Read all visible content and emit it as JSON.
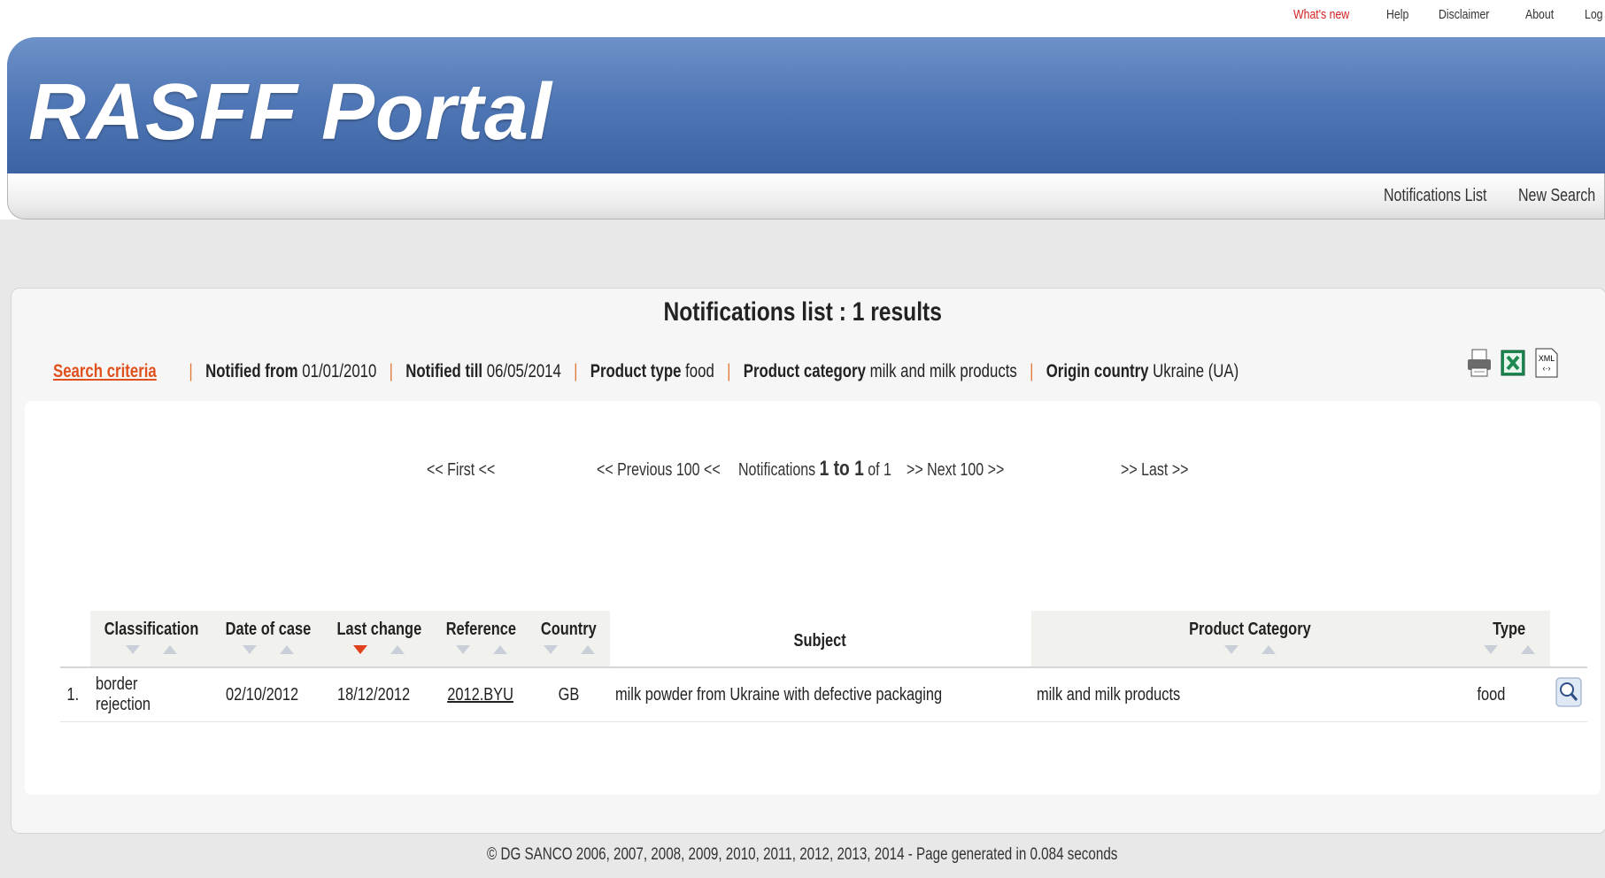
{
  "top_links": [
    "What's new",
    "Help",
    "Disclaimer",
    "About",
    "Log in"
  ],
  "header": {
    "title": "RASFF Portal"
  },
  "nav": {
    "notifications_list": "Notifications List",
    "new_search": "New Search"
  },
  "list_title": "Notifications list : 1 results",
  "criteria": {
    "link": "Search criteria",
    "items": [
      {
        "label": "Notified from",
        "value": "01/01/2010"
      },
      {
        "label": "Notified till",
        "value": "06/05/2014"
      },
      {
        "label": "Product type",
        "value": "food"
      },
      {
        "label": "Product category",
        "value": "milk and milk products"
      },
      {
        "label": "Origin country",
        "value": "Ukraine (UA)"
      }
    ]
  },
  "pager": {
    "first": "<< First <<",
    "previous": "<< Previous 100 <<",
    "notifications_prefix": "Notifications",
    "range": "1 to 1",
    "of_text": "of 1",
    "next": ">> Next 100 >>",
    "last": ">> Last >>"
  },
  "table": {
    "columns": [
      "Classification",
      "Date of case",
      "Last change",
      "Reference",
      "Country",
      "Subject",
      "Product Category",
      "Type"
    ],
    "rows": [
      {
        "index": "1.",
        "classification": "border rejection",
        "date_of_case": "02/10/2012",
        "last_change": "18/12/2012",
        "reference": "2012.BYU",
        "country": "GB",
        "subject": "milk powder from Ukraine with defective packaging",
        "product_category": "milk and milk products",
        "type": "food"
      }
    ]
  },
  "footer": "© DG SANCO 2006, 2007, 2008, 2009, 2010, 2011, 2012, 2013, 2014 - Page generated in 0.084 seconds",
  "colors": {
    "banner": "#4f76b5",
    "accent": "#e0501c",
    "whats_new": "#d41f1f"
  }
}
